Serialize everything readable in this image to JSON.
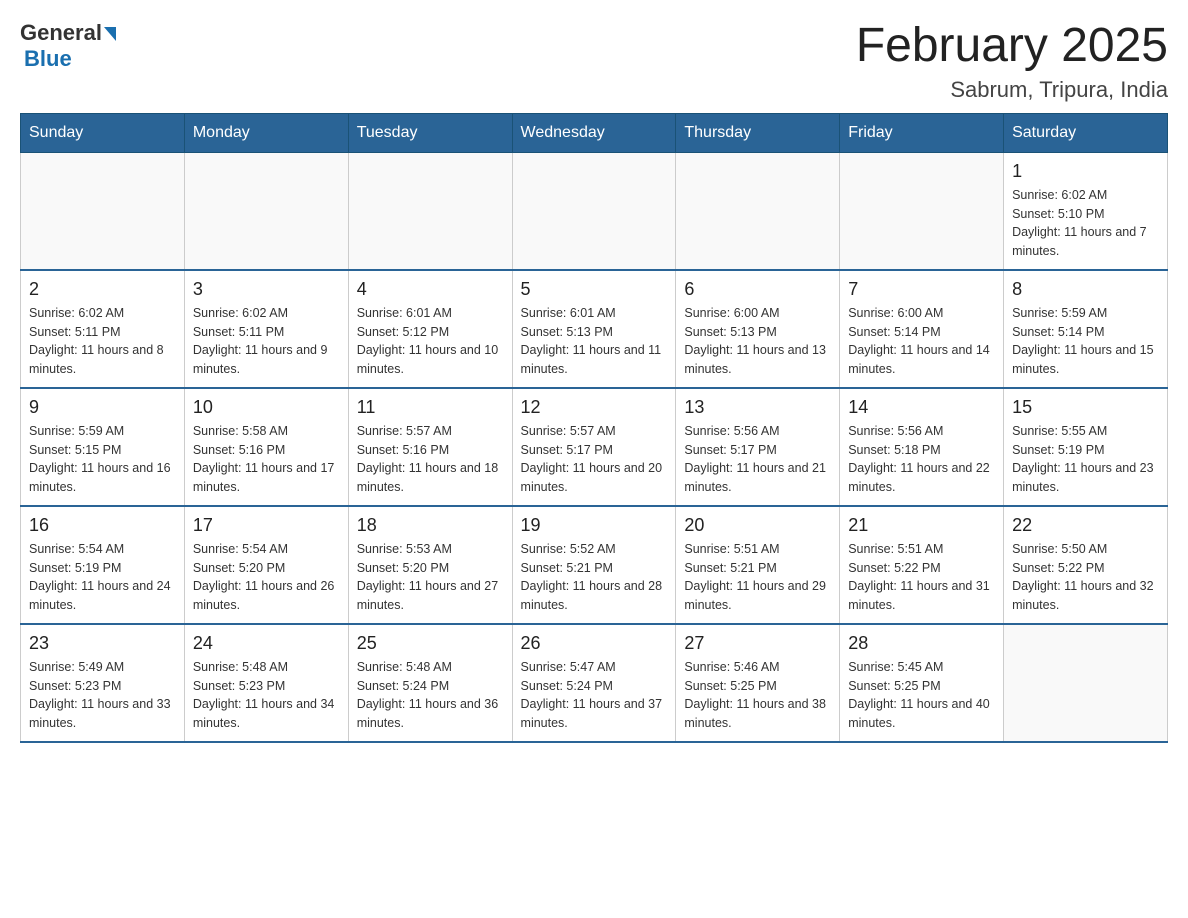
{
  "header": {
    "logo_general": "General",
    "logo_blue": "Blue",
    "title": "February 2025",
    "location": "Sabrum, Tripura, India"
  },
  "weekdays": [
    "Sunday",
    "Monday",
    "Tuesday",
    "Wednesday",
    "Thursday",
    "Friday",
    "Saturday"
  ],
  "weeks": [
    [
      {
        "day": "",
        "info": ""
      },
      {
        "day": "",
        "info": ""
      },
      {
        "day": "",
        "info": ""
      },
      {
        "day": "",
        "info": ""
      },
      {
        "day": "",
        "info": ""
      },
      {
        "day": "",
        "info": ""
      },
      {
        "day": "1",
        "info": "Sunrise: 6:02 AM\nSunset: 5:10 PM\nDaylight: 11 hours and 7 minutes."
      }
    ],
    [
      {
        "day": "2",
        "info": "Sunrise: 6:02 AM\nSunset: 5:11 PM\nDaylight: 11 hours and 8 minutes."
      },
      {
        "day": "3",
        "info": "Sunrise: 6:02 AM\nSunset: 5:11 PM\nDaylight: 11 hours and 9 minutes."
      },
      {
        "day": "4",
        "info": "Sunrise: 6:01 AM\nSunset: 5:12 PM\nDaylight: 11 hours and 10 minutes."
      },
      {
        "day": "5",
        "info": "Sunrise: 6:01 AM\nSunset: 5:13 PM\nDaylight: 11 hours and 11 minutes."
      },
      {
        "day": "6",
        "info": "Sunrise: 6:00 AM\nSunset: 5:13 PM\nDaylight: 11 hours and 13 minutes."
      },
      {
        "day": "7",
        "info": "Sunrise: 6:00 AM\nSunset: 5:14 PM\nDaylight: 11 hours and 14 minutes."
      },
      {
        "day": "8",
        "info": "Sunrise: 5:59 AM\nSunset: 5:14 PM\nDaylight: 11 hours and 15 minutes."
      }
    ],
    [
      {
        "day": "9",
        "info": "Sunrise: 5:59 AM\nSunset: 5:15 PM\nDaylight: 11 hours and 16 minutes."
      },
      {
        "day": "10",
        "info": "Sunrise: 5:58 AM\nSunset: 5:16 PM\nDaylight: 11 hours and 17 minutes."
      },
      {
        "day": "11",
        "info": "Sunrise: 5:57 AM\nSunset: 5:16 PM\nDaylight: 11 hours and 18 minutes."
      },
      {
        "day": "12",
        "info": "Sunrise: 5:57 AM\nSunset: 5:17 PM\nDaylight: 11 hours and 20 minutes."
      },
      {
        "day": "13",
        "info": "Sunrise: 5:56 AM\nSunset: 5:17 PM\nDaylight: 11 hours and 21 minutes."
      },
      {
        "day": "14",
        "info": "Sunrise: 5:56 AM\nSunset: 5:18 PM\nDaylight: 11 hours and 22 minutes."
      },
      {
        "day": "15",
        "info": "Sunrise: 5:55 AM\nSunset: 5:19 PM\nDaylight: 11 hours and 23 minutes."
      }
    ],
    [
      {
        "day": "16",
        "info": "Sunrise: 5:54 AM\nSunset: 5:19 PM\nDaylight: 11 hours and 24 minutes."
      },
      {
        "day": "17",
        "info": "Sunrise: 5:54 AM\nSunset: 5:20 PM\nDaylight: 11 hours and 26 minutes."
      },
      {
        "day": "18",
        "info": "Sunrise: 5:53 AM\nSunset: 5:20 PM\nDaylight: 11 hours and 27 minutes."
      },
      {
        "day": "19",
        "info": "Sunrise: 5:52 AM\nSunset: 5:21 PM\nDaylight: 11 hours and 28 minutes."
      },
      {
        "day": "20",
        "info": "Sunrise: 5:51 AM\nSunset: 5:21 PM\nDaylight: 11 hours and 29 minutes."
      },
      {
        "day": "21",
        "info": "Sunrise: 5:51 AM\nSunset: 5:22 PM\nDaylight: 11 hours and 31 minutes."
      },
      {
        "day": "22",
        "info": "Sunrise: 5:50 AM\nSunset: 5:22 PM\nDaylight: 11 hours and 32 minutes."
      }
    ],
    [
      {
        "day": "23",
        "info": "Sunrise: 5:49 AM\nSunset: 5:23 PM\nDaylight: 11 hours and 33 minutes."
      },
      {
        "day": "24",
        "info": "Sunrise: 5:48 AM\nSunset: 5:23 PM\nDaylight: 11 hours and 34 minutes."
      },
      {
        "day": "25",
        "info": "Sunrise: 5:48 AM\nSunset: 5:24 PM\nDaylight: 11 hours and 36 minutes."
      },
      {
        "day": "26",
        "info": "Sunrise: 5:47 AM\nSunset: 5:24 PM\nDaylight: 11 hours and 37 minutes."
      },
      {
        "day": "27",
        "info": "Sunrise: 5:46 AM\nSunset: 5:25 PM\nDaylight: 11 hours and 38 minutes."
      },
      {
        "day": "28",
        "info": "Sunrise: 5:45 AM\nSunset: 5:25 PM\nDaylight: 11 hours and 40 minutes."
      },
      {
        "day": "",
        "info": ""
      }
    ]
  ]
}
